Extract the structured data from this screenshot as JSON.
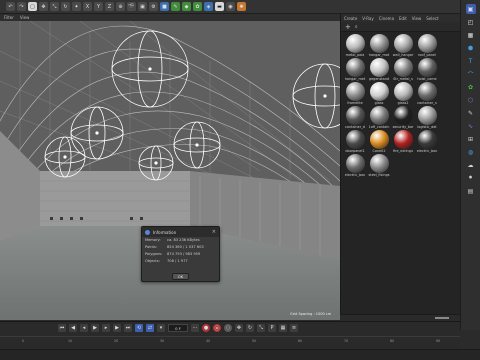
{
  "vp_menu": [
    "Filter",
    "View"
  ],
  "viewport_label": "Grid Spacing : 1000 cm",
  "dialog": {
    "title": "Information",
    "rows": [
      {
        "k": "Memory:",
        "v": "ca. 83 236 KBytes"
      },
      {
        "k": "Points:",
        "v": "854 360 / 1 037 603"
      },
      {
        "k": "Polygons:",
        "v": "874 793 / 983 959"
      },
      {
        "k": "Objects:",
        "v": "708 / 1 977"
      }
    ],
    "ok": "OK"
  },
  "mat_menu": [
    "Create",
    "V-Ray",
    "Cinema",
    "Edit",
    "View",
    "Select"
  ],
  "materials": [
    {
      "label": "metal_pola",
      "color": "#b9b9b9"
    },
    {
      "label": "hangar_mat",
      "color": "#8f8f8f"
    },
    {
      "label": "wall_hangar",
      "color": "#a5a5a5"
    },
    {
      "label": "roof_panel",
      "color": "#9a9a9a"
    },
    {
      "label": "hangar_met",
      "color": "#707070"
    },
    {
      "label": "gegenstand",
      "color": "#c2c2c2"
    },
    {
      "label": "Str_metal_s",
      "color": "#7d7d7d"
    },
    {
      "label": "hoist_came",
      "color": "#5e5e5e"
    },
    {
      "label": "framelite",
      "color": "#8d8d8d"
    },
    {
      "label": "glass",
      "color": "#cfcfcf"
    },
    {
      "label": "glass2",
      "color": "#b6b6b6"
    },
    {
      "label": "container_s",
      "color": "#6a6a6a"
    },
    {
      "label": "container_d",
      "color": "#545454"
    },
    {
      "label": "1off_contain",
      "color": "#7a7a7a"
    },
    {
      "label": "security_bar",
      "color": "#1f1f1f"
    },
    {
      "label": "logistic_dat",
      "color": "#9a9a9a"
    },
    {
      "label": "doorpanel1",
      "color": "#4a4a4a"
    },
    {
      "label": "Cone02",
      "color": "#d88a1e"
    },
    {
      "label": "fire_extingu",
      "color": "#b02020"
    },
    {
      "label": "electric_box",
      "color": "#3a3a3a"
    },
    {
      "label": "electric_box",
      "color": "#6b6b6b"
    },
    {
      "label": "steel_fixings",
      "color": "#8a8a8a"
    }
  ],
  "frame_field": "0 F",
  "ruler_ticks": [
    "0",
    "10",
    "20",
    "30",
    "40",
    "50",
    "60",
    "70",
    "80",
    "90"
  ],
  "colors": {
    "accent_blue": "#3d5fb0",
    "record_red": "#b03434",
    "orange": "#d88a1e"
  }
}
